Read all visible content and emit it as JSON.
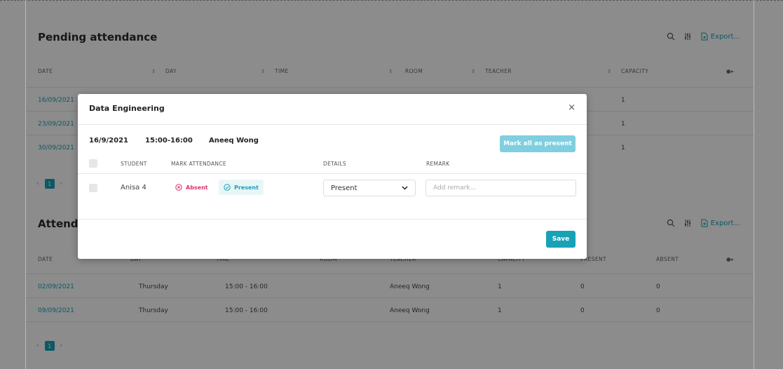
{
  "pending": {
    "title": "Pending attendance",
    "export_label": "Export...",
    "columns": [
      "DATE",
      "DAY",
      "TIME",
      "ROOM",
      "TEACHER",
      "CAPACITY"
    ],
    "rows": [
      {
        "date": "16/09/2021",
        "capacity": "1"
      },
      {
        "date": "23/09/2021",
        "capacity": "1"
      },
      {
        "date": "30/09/2021",
        "capacity": "1"
      }
    ],
    "page": "1"
  },
  "attendance": {
    "title": "Attendance",
    "export_label": "Export...",
    "columns": [
      "DATE",
      "DAY",
      "TIME",
      "ROOM",
      "TEACHER",
      "CAPACITY",
      "PRESENT",
      "ABSENT"
    ],
    "rows": [
      {
        "date": "02/09/2021",
        "day": "Thursday",
        "time": "15:00 - 16:00",
        "teacher": "Aneeq Wong",
        "capacity": "1",
        "present": "0",
        "absent": "0"
      },
      {
        "date": "09/09/2021",
        "day": "Thursday",
        "time": "15:00 - 16:00",
        "teacher": "Aneeq Wong",
        "capacity": "1",
        "present": "0",
        "absent": "0"
      }
    ],
    "page": "1"
  },
  "modal": {
    "title": "Data Engineering",
    "close": "×",
    "date": "16/9/2021",
    "time": "15:00-16:00",
    "teacher": "Aneeq Wong",
    "mark_all_label": "Mark all as present",
    "headers": {
      "student": "STUDENT",
      "mark": "MARK ATTENDANCE",
      "details": "DETAILS",
      "remark": "REMARK"
    },
    "student": {
      "name": "Anisa 4",
      "absent_label": "Absent",
      "present_label": "Present",
      "details_value": "Present",
      "remark_placeholder": "Add remark..."
    },
    "save_label": "Save"
  },
  "colors": {
    "accent": "#17a2b8",
    "absent": "#e0336b",
    "accent_light": "#7fcfe0"
  }
}
